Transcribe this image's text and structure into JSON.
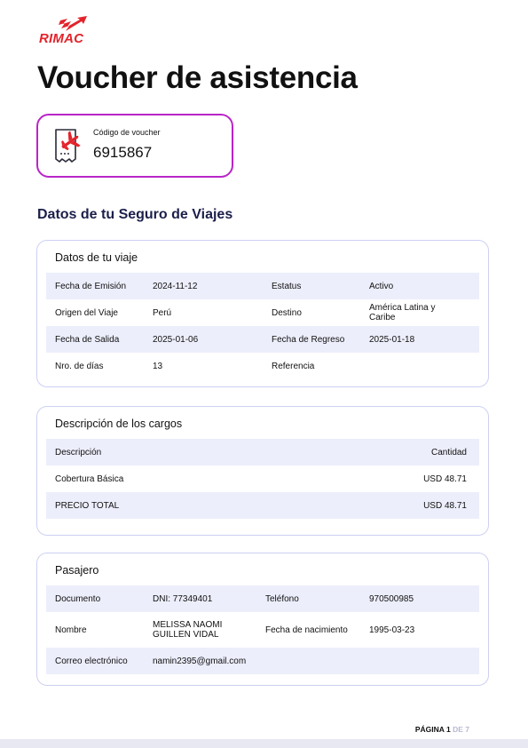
{
  "brand": {
    "name": "RIMAC",
    "color": "#e3232b"
  },
  "title": "Voucher de asistencia",
  "voucher": {
    "label": "Código de voucher",
    "code": "6915867",
    "icon": "airplane-receipt-icon",
    "accent": "#b925c8"
  },
  "section_title": "Datos de tu Seguro de Viajes",
  "trip": {
    "title": "Datos de tu viaje",
    "rows": [
      {
        "l1": "Fecha de Emisión",
        "v1": "2024-11-12",
        "l2": "Estatus",
        "v2": "Activo"
      },
      {
        "l1": "Origen del Viaje",
        "v1": "Perú",
        "l2": "Destino",
        "v2": "América Latina y Caribe"
      },
      {
        "l1": "Fecha de Salida",
        "v1": "2025-01-06",
        "l2": "Fecha de Regreso",
        "v2": "2025-01-18"
      },
      {
        "l1": "Nro. de días",
        "v1": "13",
        "l2": "Referencia",
        "v2": ""
      }
    ]
  },
  "charges": {
    "title": "Descripción de los cargos",
    "header": {
      "desc": "Descripción",
      "amount": "Cantidad"
    },
    "rows": [
      {
        "desc": "Cobertura Básica",
        "amount": "USD 48.71"
      },
      {
        "desc": "PRECIO TOTAL",
        "amount": "USD 48.71"
      }
    ]
  },
  "passenger": {
    "title": "Pasajero",
    "rows": [
      {
        "l1": "Documento",
        "v1": "DNI: 77349401",
        "l2": "Teléfono",
        "v2": "970500985"
      },
      {
        "l1": "Nombre",
        "v1": "MELISSA NAOMI GUILLEN VIDAL",
        "l2": "Fecha de nacimiento",
        "v2": "1995-03-23"
      },
      {
        "l1": "Correo electrónico",
        "v1": "namin2395@gmail.com"
      }
    ]
  },
  "footer": {
    "page_label": "PÁGINA",
    "page_num": "1",
    "of_label": "DE",
    "total": "7"
  }
}
